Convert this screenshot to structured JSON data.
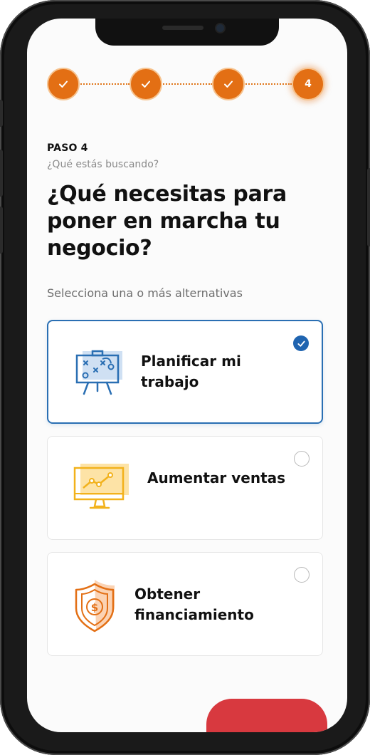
{
  "stepper": {
    "steps": [
      {
        "state": "done",
        "icon": "check-icon"
      },
      {
        "state": "done",
        "icon": "check-icon"
      },
      {
        "state": "done",
        "icon": "check-icon"
      },
      {
        "state": "current",
        "label": "4"
      }
    ]
  },
  "header": {
    "step_label": "PASO 4",
    "subtitle": "¿Qué estás buscando?",
    "title": "¿Qué necesitas para poner en marcha tu negocio?"
  },
  "hint": "Selecciona una o más alternativas",
  "options": [
    {
      "label": "Planificar mi trabajo",
      "icon": "strategy-board-icon",
      "selected": true
    },
    {
      "label": "Aumentar ventas",
      "icon": "sales-chart-monitor-icon",
      "selected": false
    },
    {
      "label": "Obtener financiamiento",
      "icon": "shield-dollar-icon",
      "selected": false
    }
  ],
  "colors": {
    "accent_orange": "#e36f14",
    "selected_blue": "#2a6fb3",
    "cta_red": "#d8393f"
  }
}
